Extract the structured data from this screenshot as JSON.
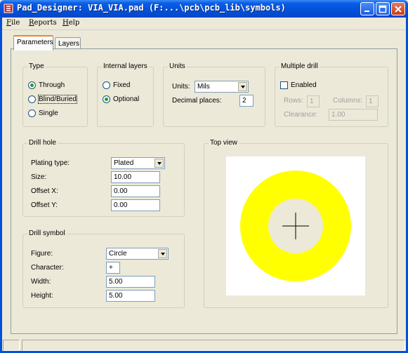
{
  "window": {
    "title": "Pad_Designer: VIA_VIA.pad (F:...\\pcb\\pcb_lib\\symbols)",
    "buttons": [
      "minimize-icon",
      "maximize-icon",
      "close-icon"
    ]
  },
  "menu": {
    "file": "File",
    "reports": "Reports",
    "help": "Help"
  },
  "tabs": {
    "parameters": "Parameters",
    "layers": "Layers",
    "active": "Parameters"
  },
  "type_group": {
    "legend": "Type",
    "options": [
      "Through",
      "Blind/Buried",
      "Single"
    ],
    "selected": "Through"
  },
  "internal_layers": {
    "legend": "Internal layers",
    "options": [
      "Fixed",
      "Optional"
    ],
    "selected": "Optional"
  },
  "units": {
    "legend": "Units",
    "units_label": "Units:",
    "units_value": "Mils",
    "decimal_label": "Decimal places:",
    "decimal_value": "2"
  },
  "multiple_drill": {
    "legend": "Multiple drill",
    "enabled_label": "Enabled",
    "enabled": false,
    "rows_label": "Rows:",
    "rows_value": "1",
    "columns_label": "Columns:",
    "columns_value": "1",
    "clearance_label": "Clearance:",
    "clearance_value": "1.00"
  },
  "drill_hole": {
    "legend": "Drill hole",
    "plating_label": "Plating type:",
    "plating_value": "Plated",
    "size_label": "Size:",
    "size_value": "10.00",
    "offset_x_label": "Offset X:",
    "offset_x_value": "0.00",
    "offset_y_label": "Offset Y:",
    "offset_y_value": "0.00"
  },
  "drill_symbol": {
    "legend": "Drill symbol",
    "figure_label": "Figure:",
    "figure_value": "Circle",
    "character_label": "Character:",
    "character_value": "+",
    "width_label": "Width:",
    "width_value": "5.00",
    "height_label": "Height:",
    "height_value": "5.00"
  },
  "top_view": {
    "legend": "Top view",
    "pad_color": "#ffff00",
    "hole_color": "#ece9d8",
    "canvas_color": "#ffffff"
  },
  "colors": {
    "titlebar": "#0450d8",
    "tab_highlight": "#e68b2c",
    "window_bg": "#ece9d8"
  }
}
